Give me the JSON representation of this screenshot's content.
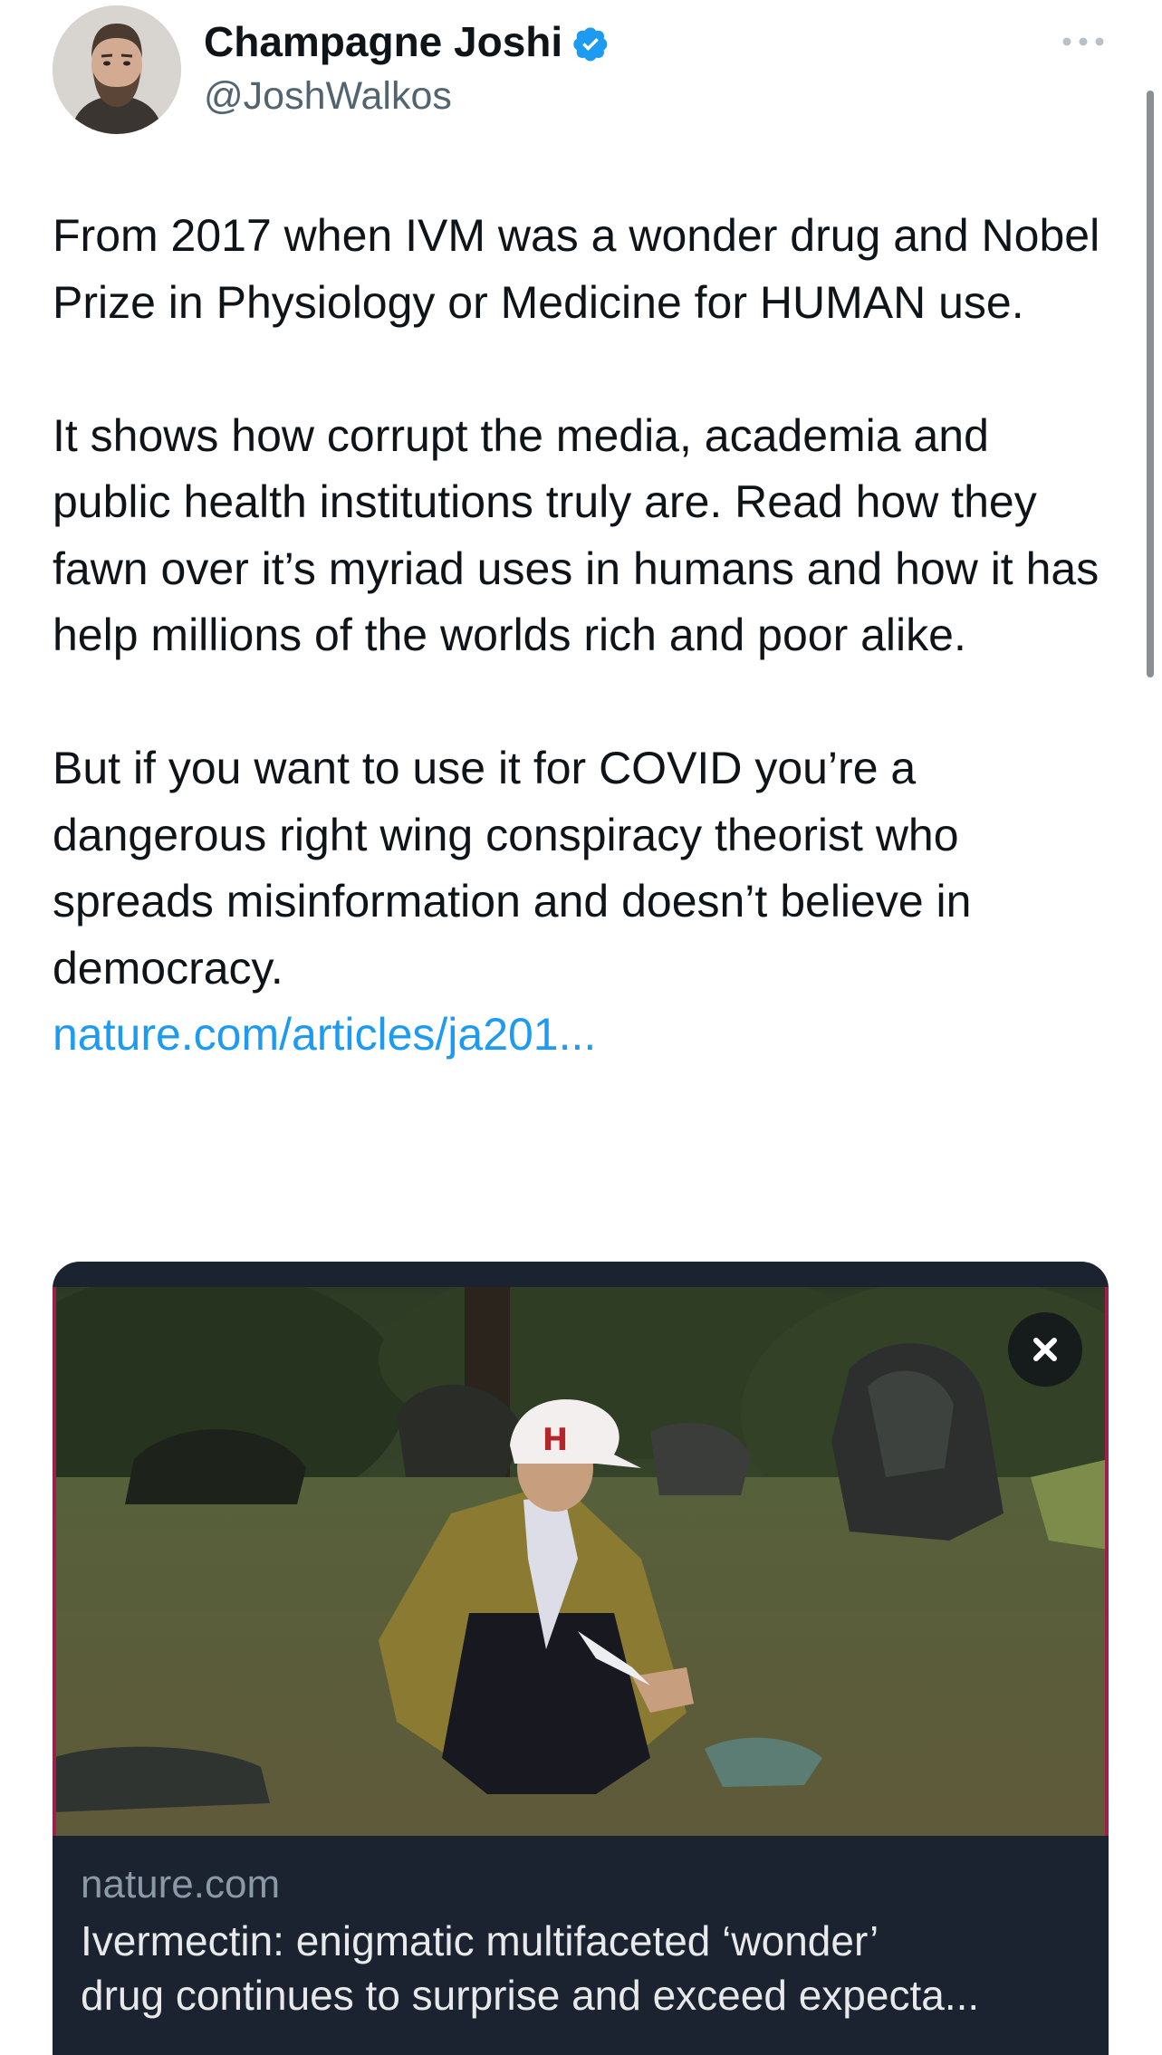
{
  "author": {
    "display_name": "Champagne Joshi",
    "handle": "@JoshWalkos",
    "avatar_icon": "bearded-man-portrait",
    "verified_icon": "verified-badge-icon",
    "verified_color": "#1d9bf0"
  },
  "more_icon": "more-dots-icon",
  "tweet": {
    "paragraphs": [
      "From 2017 when IVM was a wonder drug and Nobel Prize in Physiology or Medicine for HUMAN use.",
      "It shows how corrupt the media, academia and public health institutions truly are. Read how they fawn over it’s myriad uses in humans and how it has help millions of the worlds rich and poor alike.",
      "But if you want to use it for COVID you’re a dangerous right wing conspiracy theorist who spreads misinformation and doesn’t believe in democracy."
    ],
    "link_text": "nature.com/articles/ja201..."
  },
  "card": {
    "image_icon": "man-crouching-on-grass-photo",
    "close_icon": "close-x-icon",
    "domain": "nature.com",
    "title_line_1": "Ivermectin: enigmatic multifaceted ‘wonder’",
    "title_line_2": "drug continues to surprise and exceed expecta..."
  },
  "colors": {
    "text": "#0f1419",
    "secondary_text": "#536471",
    "link": "#1d9bf0",
    "card_background": "#1b2330"
  }
}
